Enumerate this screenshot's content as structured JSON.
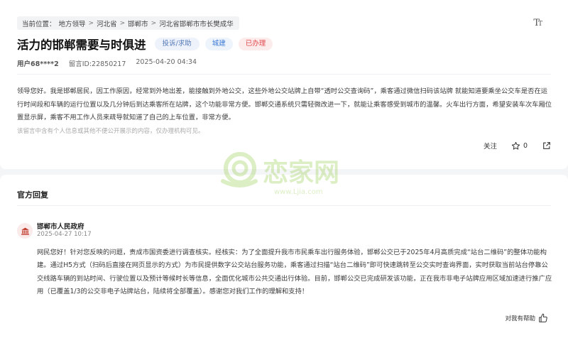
{
  "breadcrumb": {
    "prefix": "当前位置：",
    "items": [
      "地方领导",
      "河北省",
      "邯郸市",
      "河北省邯郸市市长樊成华"
    ],
    "separator": ">"
  },
  "font_toggle": {
    "big": "T",
    "small": "T",
    "icon": "font-size-icon"
  },
  "message": {
    "title": "活力的邯郸需要与时俱进",
    "tags": {
      "type": "投诉/求助",
      "field": "城建",
      "status": "已办理"
    },
    "user": "用户68****2",
    "id_label": "留言ID:22850217",
    "datetime": "2025-04-20 04:34",
    "body": "领导您好。我是邯郸居民，因工作原因，经常到外地出差，能接触到外地公交，这些外地公交站牌上自带“透时公交查询码”，乘客通过微信扫码该站牌 就能知道要乘坐公交车是否在运行时间段和车辆的运行位置以及几分钟后到达乘客所在站牌，这个功能非常方便。邯郸交通系统只需轻微改进一下，就能让乘客感受到城市的温馨。火车出行方面，希望安装车次车厢位置显示屏，乘客不用工作人员来疏导就知道了自己的上车位置，非常方便。",
    "privacy_note": "该留言中含有个人信息或其他不便公开展示的内容，仅办理机构可见。"
  },
  "actions": {
    "follow": "关注",
    "star_count": "0",
    "star_icon": "star-icon",
    "share_icon": "share-icon"
  },
  "watermark": {
    "text": "恋家网",
    "url": "www.Ljia.com"
  },
  "reply": {
    "heading": "官方回复",
    "org": "邯郸市人民政府",
    "date": "2025-04-27 10:17",
    "body": "网民您好！针对您反映的问题，责成市国资委进行调查核实。经核实：为了全面提升我市市民乘车出行服务体验，邯郸公交已于2025年4月高质完成“站台二维码”的整体功能构建。通过H5方式（扫码后直接在网页显示的方式）为市民提供数字公交站台服务功能，乘客通过扫描“站台二维码”即可快速跳转至公交实时查询界面，实时获取当前站台停靠公交线路车辆的到站时间、行驶位置以及预计等候时长等信息，全面优化城市公共交通出行体验。目前，邯郸公交已完成研发该功能，正在我市非电子站牌应用区域加速进行推广应用（已覆盖1/3的公交非电子站牌站台，陆续将全部覆盖）。感谢您对我们工作的理解和支持！",
    "helpful_label": "对我有帮助",
    "helpful_icon": "thumbs-up-icon"
  },
  "colors": {
    "tag_status": "#e0474b",
    "tag_field": "#3d7bd4",
    "gov_red": "#c0392b"
  }
}
